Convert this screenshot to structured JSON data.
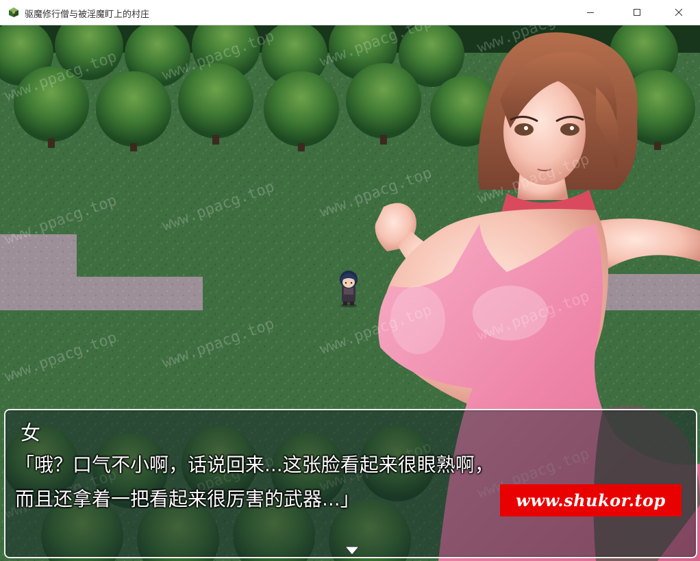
{
  "window": {
    "title": "驱魔修行僧与被淫魔盯上的村庄",
    "controls": [
      "minimize",
      "maximize",
      "close"
    ],
    "icon": "game-app-icon"
  },
  "scene": {
    "location": "forest clearing with dirt path",
    "player_sprite": "monk-character",
    "watermark_text": "www.ppacg.top"
  },
  "dialogue": {
    "speaker": "女",
    "lines": [
      "「哦？口气不小啊，话说回来...这张脸看起来很眼熟啊，",
      "而且还拿着一把看起来很厉害的武器...」"
    ],
    "continue_indicator": "pause-arrow-icon"
  },
  "badge": {
    "text": "www.shukor.top",
    "color": "#e90000"
  },
  "colors": {
    "grass": "#3d6b3f",
    "path": "#9c8f98",
    "tree_dark": "#1f4a24",
    "tree_light": "#4d8a3c",
    "outfit_pink": "#f29ab8",
    "hair_brown": "#9a5a3e"
  }
}
